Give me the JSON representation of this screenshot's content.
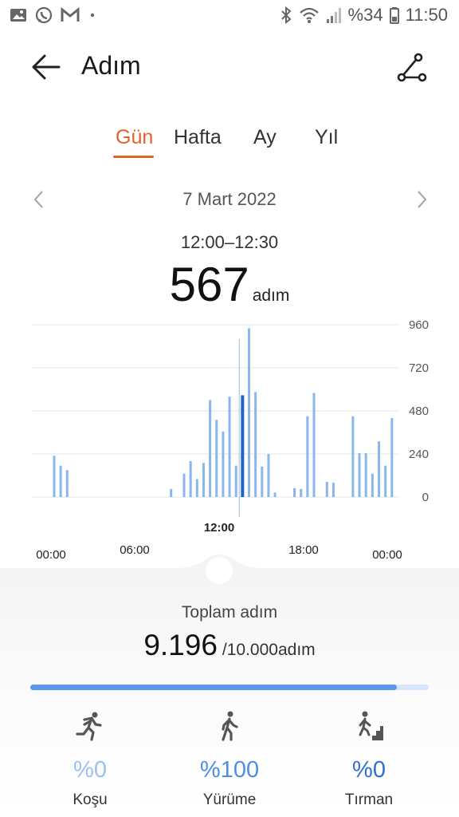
{
  "status_bar": {
    "battery_text": "%34",
    "time": "11:50"
  },
  "header": {
    "title": "Adım"
  },
  "tabs": [
    {
      "label": "Gün",
      "active": true
    },
    {
      "label": "Hafta",
      "active": false
    },
    {
      "label": "Ay",
      "active": false
    },
    {
      "label": "Yıl",
      "active": false
    }
  ],
  "date_nav": {
    "date": "7 Mart 2022"
  },
  "selection": {
    "time_range": "12:00–12:30",
    "value": "567",
    "unit": "adım",
    "selected_label": "12:00"
  },
  "chart_data": {
    "type": "bar",
    "ylim": [
      0,
      960
    ],
    "y_ticks": [
      "960",
      "720",
      "480",
      "240",
      "0"
    ],
    "x_ticks": [
      "00:00",
      "06:00",
      "18:00",
      "00:00"
    ],
    "bar_color": "#8ab6ee",
    "selected_color": "#1f63c8",
    "points": [
      {
        "h": 0.5,
        "v": 230
      },
      {
        "h": 1.0,
        "v": 175
      },
      {
        "h": 1.5,
        "v": 150
      },
      {
        "h": 9.5,
        "v": 45
      },
      {
        "h": 10.5,
        "v": 130
      },
      {
        "h": 11.0,
        "v": 200
      },
      {
        "h": 11.5,
        "v": 100
      },
      {
        "h": 12.0,
        "v": 190
      },
      {
        "h": 12.5,
        "v": 540
      },
      {
        "h": 13.0,
        "v": 430
      },
      {
        "h": 13.5,
        "v": 365
      },
      {
        "h": 14.0,
        "v": 560
      },
      {
        "h": 14.5,
        "v": 175
      },
      {
        "h": 15.0,
        "v": 567,
        "selected": true
      },
      {
        "h": 15.5,
        "v": 940
      },
      {
        "h": 16.0,
        "v": 585
      },
      {
        "h": 16.5,
        "v": 170
      },
      {
        "h": 17.0,
        "v": 240
      },
      {
        "h": 17.5,
        "v": 25
      },
      {
        "h": 19.0,
        "v": 50
      },
      {
        "h": 19.5,
        "v": 45
      },
      {
        "h": 20.0,
        "v": 450
      },
      {
        "h": 20.5,
        "v": 580
      },
      {
        "h": 21.5,
        "v": 85
      },
      {
        "h": 22.0,
        "v": 80
      },
      {
        "h": 23.5,
        "v": 450
      },
      {
        "h": 24.0,
        "v": 245
      },
      {
        "h": 24.5,
        "v": 245
      },
      {
        "h": 25.0,
        "v": 130
      },
      {
        "h": 25.5,
        "v": 310
      },
      {
        "h": 26.0,
        "v": 175
      },
      {
        "h": 26.5,
        "v": 440
      }
    ]
  },
  "summary": {
    "total_label": "Toplam adım",
    "total_value": "9.196",
    "goal_text": "/10.000adım",
    "progress": 0.92,
    "progress_color": "#5a98ea"
  },
  "activities": [
    {
      "icon": "running-icon",
      "percent": "%0",
      "label": "Koşu",
      "color": "#9cc1f0"
    },
    {
      "icon": "walking-icon",
      "percent": "%100",
      "label": "Yürüme",
      "color": "#4d8fe6"
    },
    {
      "icon": "climbing-icon",
      "percent": "%0",
      "label": "Tırman",
      "color": "#2f6fd0"
    }
  ]
}
